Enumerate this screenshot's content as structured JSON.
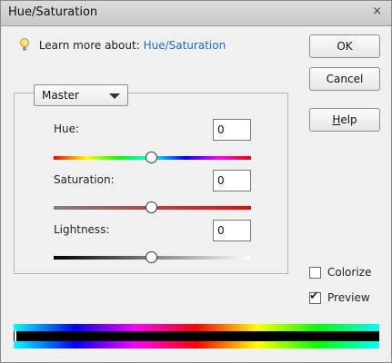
{
  "window": {
    "title": "Hue/Saturation",
    "close_glyph": "×"
  },
  "learn_more": {
    "text": "Learn more about:",
    "link": "Hue/Saturation",
    "icon": "lightbulb-icon"
  },
  "buttons": {
    "ok": "OK",
    "cancel": "Cancel",
    "help": "Help"
  },
  "channel": {
    "selected": "Master"
  },
  "sliders": {
    "hue": {
      "label": "Hue:",
      "value": "0"
    },
    "saturation": {
      "label": "Saturation:",
      "value": "0"
    },
    "lightness": {
      "label": "Lightness:",
      "value": "0"
    }
  },
  "options": {
    "colorize": {
      "label": "Colorize",
      "checked": false
    },
    "preview": {
      "label": "Preview",
      "checked": true
    }
  },
  "colors": {
    "link": "#1f6bd1"
  }
}
